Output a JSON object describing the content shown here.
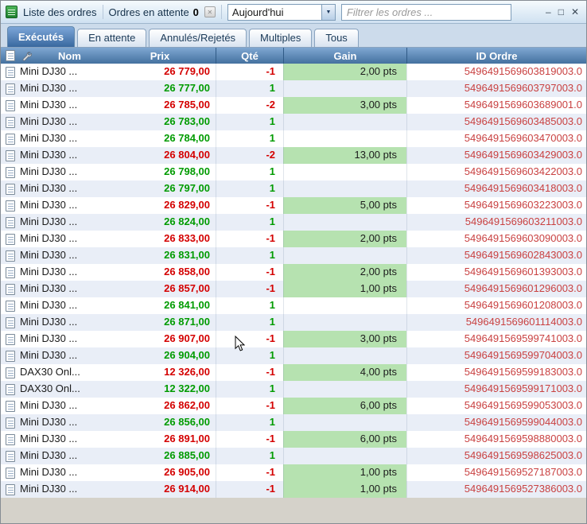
{
  "window": {
    "title": "Liste des ordres",
    "pending": {
      "label": "Ordres en attente",
      "count": "0"
    },
    "period_dropdown": {
      "value": "Aujourd'hui"
    },
    "filter": {
      "placeholder": "Filtrer les ordres ..."
    },
    "controls": {
      "minimize": "–",
      "maximize": "□",
      "close": "✕"
    }
  },
  "icons": {
    "app": "orders-book-icon",
    "pending_close": "✕",
    "dropdown_arrow": "▼"
  },
  "tabs": [
    {
      "label": "Exécutés",
      "active": true
    },
    {
      "label": "En attente",
      "active": false
    },
    {
      "label": "Annulés/Rejetés",
      "active": false
    },
    {
      "label": "Multiples",
      "active": false
    },
    {
      "label": "Tous",
      "active": false
    }
  ],
  "table": {
    "columns": [
      "Nom",
      "Prix",
      "Qté",
      "Gain",
      "ID Ordre"
    ],
    "rows": [
      {
        "name": "Mini DJ30 ...",
        "price": "26 779,00",
        "qty": "-1",
        "gain": "2,00 pts",
        "id": "5496491569603819003.0"
      },
      {
        "name": "Mini DJ30 ...",
        "price": "26 777,00",
        "qty": "1",
        "gain": "",
        "id": "5496491569603797003.0"
      },
      {
        "name": "Mini DJ30 ...",
        "price": "26 785,00",
        "qty": "-2",
        "gain": "3,00 pts",
        "id": "5496491569603689001.0"
      },
      {
        "name": "Mini DJ30 ...",
        "price": "26 783,00",
        "qty": "1",
        "gain": "",
        "id": "5496491569603485003.0"
      },
      {
        "name": "Mini DJ30 ...",
        "price": "26 784,00",
        "qty": "1",
        "gain": "",
        "id": "5496491569603470003.0"
      },
      {
        "name": "Mini DJ30 ...",
        "price": "26 804,00",
        "qty": "-2",
        "gain": "13,00 pts",
        "id": "5496491569603429003.0"
      },
      {
        "name": "Mini DJ30 ...",
        "price": "26 798,00",
        "qty": "1",
        "gain": "",
        "id": "5496491569603422003.0"
      },
      {
        "name": "Mini DJ30 ...",
        "price": "26 797,00",
        "qty": "1",
        "gain": "",
        "id": "5496491569603418003.0"
      },
      {
        "name": "Mini DJ30 ...",
        "price": "26 829,00",
        "qty": "-1",
        "gain": "5,00 pts",
        "id": "5496491569603223003.0"
      },
      {
        "name": "Mini DJ30 ...",
        "price": "26 824,00",
        "qty": "1",
        "gain": "",
        "id": "5496491569603211003.0"
      },
      {
        "name": "Mini DJ30 ...",
        "price": "26 833,00",
        "qty": "-1",
        "gain": "2,00 pts",
        "id": "5496491569603090003.0"
      },
      {
        "name": "Mini DJ30 ...",
        "price": "26 831,00",
        "qty": "1",
        "gain": "",
        "id": "5496491569602843003.0"
      },
      {
        "name": "Mini DJ30 ...",
        "price": "26 858,00",
        "qty": "-1",
        "gain": "2,00 pts",
        "id": "5496491569601393003.0"
      },
      {
        "name": "Mini DJ30 ...",
        "price": "26 857,00",
        "qty": "-1",
        "gain": "1,00 pts",
        "id": "5496491569601296003.0"
      },
      {
        "name": "Mini DJ30 ...",
        "price": "26 841,00",
        "qty": "1",
        "gain": "",
        "id": "5496491569601208003.0"
      },
      {
        "name": "Mini DJ30 ...",
        "price": "26 871,00",
        "qty": "1",
        "gain": "",
        "id": "5496491569601114003.0"
      },
      {
        "name": "Mini DJ30 ...",
        "price": "26 907,00",
        "qty": "-1",
        "gain": "3,00 pts",
        "id": "5496491569599741003.0"
      },
      {
        "name": "Mini DJ30 ...",
        "price": "26 904,00",
        "qty": "1",
        "gain": "",
        "id": "5496491569599704003.0"
      },
      {
        "name": "DAX30 Onl...",
        "price": "12 326,00",
        "qty": "-1",
        "gain": "4,00 pts",
        "id": "5496491569599183003.0"
      },
      {
        "name": "DAX30 Onl...",
        "price": "12 322,00",
        "qty": "1",
        "gain": "",
        "id": "5496491569599171003.0"
      },
      {
        "name": "Mini DJ30 ...",
        "price": "26 862,00",
        "qty": "-1",
        "gain": "6,00 pts",
        "id": "5496491569599053003.0"
      },
      {
        "name": "Mini DJ30 ...",
        "price": "26 856,00",
        "qty": "1",
        "gain": "",
        "id": "5496491569599044003.0"
      },
      {
        "name": "Mini DJ30 ...",
        "price": "26 891,00",
        "qty": "-1",
        "gain": "6,00 pts",
        "id": "5496491569598880003.0"
      },
      {
        "name": "Mini DJ30 ...",
        "price": "26 885,00",
        "qty": "1",
        "gain": "",
        "id": "5496491569598625003.0"
      },
      {
        "name": "Mini DJ30 ...",
        "price": "26 905,00",
        "qty": "-1",
        "gain": "1,00 pts",
        "id": "5496491569527187003.0"
      },
      {
        "name": "Mini DJ30 ...",
        "price": "26 914,00",
        "qty": "-1",
        "gain": "1,00 pts",
        "id": "5496491569527386003.0"
      }
    ]
  },
  "colors": {
    "sell_red": "#d40000",
    "buy_green": "#009b00",
    "gain_cell_bg": "#b6e2b0",
    "order_id_red": "#c94141",
    "header_blue": "#44719f",
    "active_tab_blue": "#39689f"
  }
}
